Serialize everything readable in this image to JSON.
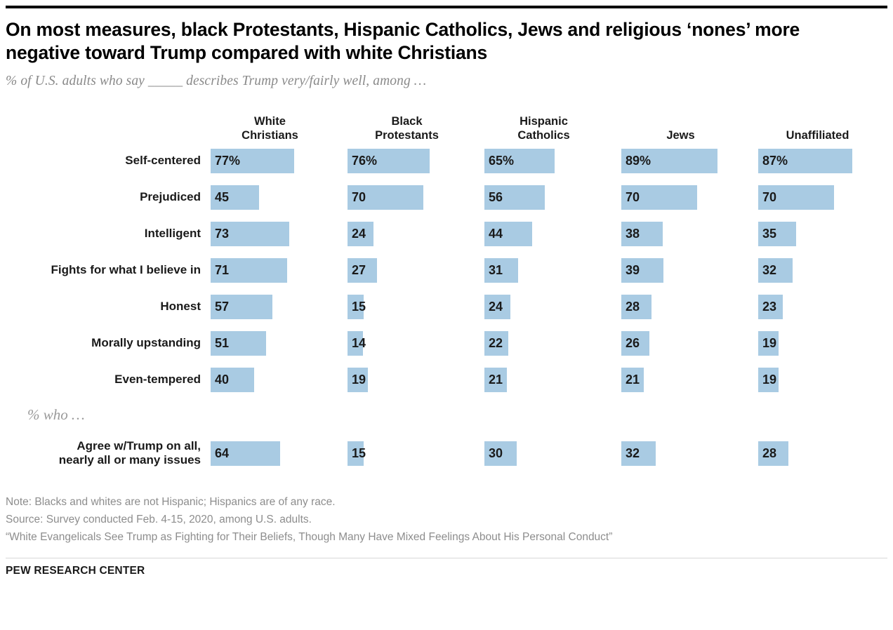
{
  "header": {
    "title": "On most measures, black Protestants, Hispanic Catholics, Jews and religious ‘nones’ more negative toward Trump compared with white Christians",
    "subtitle": "% of U.S. adults who say _____ describes Trump very/fairly well, among …"
  },
  "footer": {
    "note": "Note: Blacks and whites are not Hispanic; Hispanics are of any race.",
    "source": "Source: Survey conducted Feb. 4-15, 2020, among U.S. adults.",
    "report": "“White Evangelicals See Trump as Fighting for Their Beliefs, Though Many Have Mixed Feelings About His Personal Conduct”",
    "brand": "PEW RESEARCH CENTER"
  },
  "section_note": "% who …",
  "colors": {
    "bar": "#a9cbe3",
    "text": "#1a1a1a",
    "muted": "#8d8d8d",
    "rule": "#000000"
  },
  "chart_data": {
    "type": "bar",
    "title": "On most measures, black Protestants, Hispanic Catholics, Jews and religious ‘nones’ more negative toward Trump compared with white Christians",
    "subtitle": "% of U.S. adults who say _____ describes Trump very/fairly well, among …",
    "xlabel": "",
    "ylabel": "",
    "xlim": [
      0,
      100
    ],
    "grid": false,
    "legend": "none",
    "orientation": "horizontal",
    "group_headers": [
      {
        "line1": "White",
        "line2": "Christians"
      },
      {
        "line1": "Black",
        "line2": "Protestants"
      },
      {
        "line1": "Hispanic",
        "line2": "Catholics"
      },
      {
        "line1": "Jews",
        "line2": ""
      },
      {
        "line1": "Unaffiliated",
        "line2": ""
      }
    ],
    "categories": [
      "White Christians",
      "Black Protestants",
      "Hispanic Catholics",
      "Jews",
      "Unaffiliated"
    ],
    "rows": [
      {
        "label_line1": "Self-centered",
        "label_line2": "",
        "values": [
          77,
          76,
          65,
          89,
          87
        ],
        "display": [
          "77%",
          "76%",
          "65%",
          "89%",
          "87%"
        ]
      },
      {
        "label_line1": "Prejudiced",
        "label_line2": "",
        "values": [
          45,
          70,
          56,
          70,
          70
        ],
        "display": [
          "45",
          "70",
          "56",
          "70",
          "70"
        ]
      },
      {
        "label_line1": "Intelligent",
        "label_line2": "",
        "values": [
          73,
          24,
          44,
          38,
          35
        ],
        "display": [
          "73",
          "24",
          "44",
          "38",
          "35"
        ]
      },
      {
        "label_line1": "Fights for what I believe in",
        "label_line2": "",
        "values": [
          71,
          27,
          31,
          39,
          32
        ],
        "display": [
          "71",
          "27",
          "31",
          "39",
          "32"
        ]
      },
      {
        "label_line1": "Honest",
        "label_line2": "",
        "values": [
          57,
          15,
          24,
          28,
          23
        ],
        "display": [
          "57",
          "15",
          "24",
          "28",
          "23"
        ]
      },
      {
        "label_line1": "Morally upstanding",
        "label_line2": "",
        "values": [
          51,
          14,
          22,
          26,
          19
        ],
        "display": [
          "51",
          "14",
          "22",
          "26",
          "19"
        ]
      },
      {
        "label_line1": "Even-tempered",
        "label_line2": "",
        "values": [
          40,
          19,
          21,
          21,
          19
        ],
        "display": [
          "40",
          "19",
          "21",
          "21",
          "19"
        ]
      }
    ],
    "extra_rows": [
      {
        "label_line1": "Agree w/Trump on all,",
        "label_line2": "nearly all or many issues",
        "values": [
          64,
          15,
          30,
          32,
          28
        ],
        "display": [
          "64",
          "15",
          "30",
          "32",
          "28"
        ]
      }
    ]
  }
}
